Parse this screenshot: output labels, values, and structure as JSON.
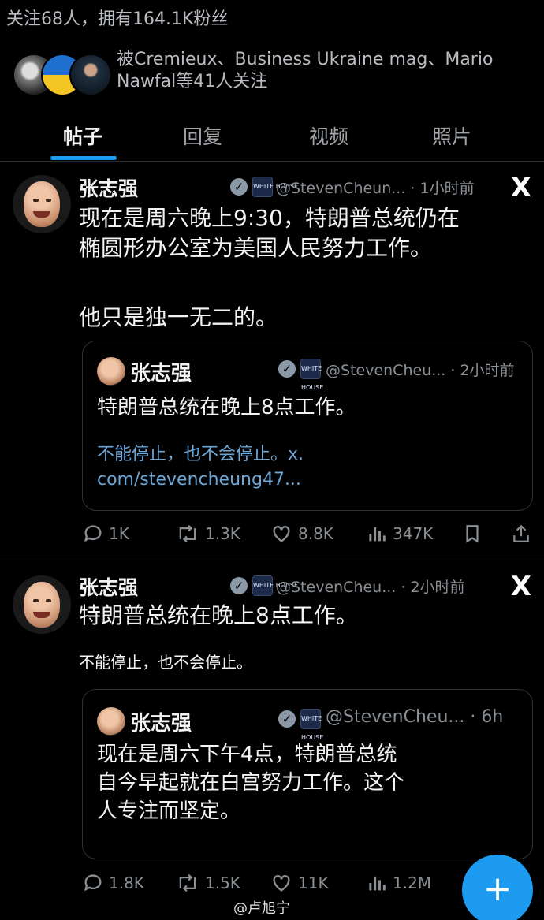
{
  "profile": {
    "stats": "关注68人，拥有164.1K粉丝",
    "followed_by_line1": "被Cremieux、Business Ukraine mag、Mario",
    "followed_by_line2": "Nawfal等41人关注"
  },
  "tabs": [
    "帖子",
    "回复",
    "视频",
    "照片"
  ],
  "tweets": [
    {
      "name": "张志强",
      "handle": "@StevenCheun... · 1小时前",
      "text_line1": "现在是周六晚上9:30，特朗普总统仍在",
      "text_line2": "椭圆形办公室为美国人民努力工作。",
      "text_para2": "他只是独一无二的。",
      "quote": {
        "name": "张志强",
        "handle": "@StevenCheu... · 2小时前",
        "text": "特朗普总统在晚上8点工作。",
        "link_line1": "不能停止，也不会停止。x.",
        "link_line2": "com/stevencheung47..."
      },
      "actions": {
        "replies": "1K",
        "reposts": "1.3K",
        "likes": "8.8K",
        "views": "347K"
      }
    },
    {
      "name": "张志强",
      "handle": "@StevenCheu... · 2小时前",
      "text": "特朗普总统在晚上8点工作。",
      "subtext": "不能停止，也不会停止。",
      "quote": {
        "name": "张志强",
        "handle": "@StevenCheu... · 6h",
        "text_line1": "现在是周六下午4点，特朗普总统",
        "text_line2": "自今早起就在白宫努力工作。这个",
        "text_line3": "人专注而坚定。"
      },
      "actions": {
        "replies": "1.8K",
        "reposts": "1.5K",
        "likes": "11K",
        "views": "1.2M"
      }
    }
  ],
  "watermark": "@卢旭宁",
  "fab_label": "+",
  "x_logo": "X",
  "affiliation_badge": "WHITE HOUSE",
  "colors": {
    "background": "#000000",
    "accent": "#1d9bf0",
    "link": "#6ca7d8",
    "muted": "#8b9095"
  }
}
